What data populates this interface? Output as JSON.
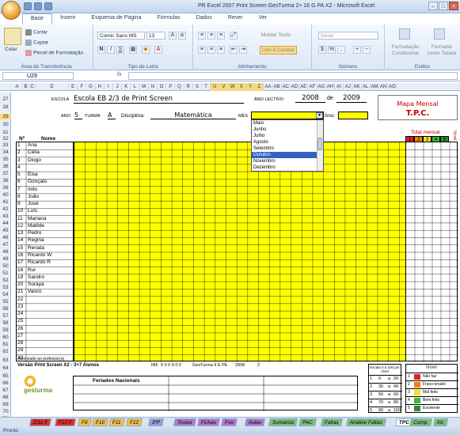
{
  "window": {
    "title": "PR Excel 2007 Print Screen GesTurma 2+ 16 G PA X2 - Microsoft Excel"
  },
  "ribbon": {
    "tabs": [
      "Base",
      "Inserir",
      "Esquema de Página",
      "Fórmulas",
      "Dados",
      "Rever",
      "Ver"
    ],
    "clipboard": {
      "paste": "Colar",
      "cut": "Cortar",
      "copy": "Copiar",
      "format_painter": "Pincel de Formatação",
      "group": "Área de Transferência"
    },
    "font": {
      "name": "Comic Sans MS",
      "size": "13",
      "group": "Tipo de Letra"
    },
    "alignment": {
      "wrap": "Moldar Texto",
      "merge": "Unir e Centrar",
      "group": "Alinhamento"
    },
    "number": {
      "format": "Geral",
      "group": "Número"
    },
    "styles": {
      "conditional": "Formatação Condicional",
      "as_table": "Formatar como Tabela",
      "group": "Estilos"
    }
  },
  "formula_bar": {
    "name_box": "U29",
    "fx": "fx"
  },
  "columns": [
    "A",
    "B",
    "C",
    "D",
    "E",
    "F",
    "G",
    "H",
    "I",
    "J",
    "K",
    "L",
    "M",
    "N",
    "O",
    "P",
    "Q",
    "R",
    "S",
    "T",
    "U",
    "V",
    "W",
    "X",
    "Y",
    "Z",
    "AA",
    "AB",
    "AC",
    "AD",
    "AE",
    "AF",
    "AG",
    "AH",
    "AI",
    "AJ",
    "AK",
    "AL",
    "AM",
    "AN",
    "AO"
  ],
  "rows": [
    "27",
    "28",
    "29",
    "30",
    "31",
    "32",
    "33",
    "34",
    "35",
    "36",
    "37",
    "38",
    "39",
    "40",
    "41",
    "42",
    "43",
    "44",
    "45",
    "46",
    "47",
    "48",
    "49",
    "50",
    "51",
    "52",
    "53",
    "54",
    "55",
    "56",
    "57",
    "58",
    "59",
    "60",
    "61",
    "62",
    "63",
    "64",
    "65",
    "66",
    "67",
    "68",
    "69",
    "70",
    "71",
    "72"
  ],
  "sheet": {
    "escola_label": "ESCOLA",
    "escola": "Escola EB 2/3 de Print Screen",
    "ano_lectivo_label": "ANO LECTIVO",
    "ano_inicio": "2008",
    "de": "de",
    "ano_fim": "2009",
    "mapa_title": "Mapa Mensal",
    "mapa_sub": "T.P.C.",
    "ano_label": "ANO",
    "ano": "5",
    "turma_label": "TURMA",
    "turma": "A",
    "disciplina_label": "Disciplina:",
    "disciplina": "Matemática",
    "mes_label": "MÊS",
    "ano2_label": "Ano:",
    "n_label": "Nº",
    "nome_label": "Nome",
    "total_label": "Total mensal",
    "nivel_side": "Nível",
    "total_cols": [
      "1",
      "2",
      "3",
      "4",
      "5"
    ],
    "month_options": [
      "Maio",
      "Junho",
      "Julho",
      "Agosto",
      "Setembro",
      "Outubro",
      "Novembro",
      "Dezembro"
    ],
    "month_selected": "Outubro",
    "students": [
      {
        "n": "1",
        "nome": "Ana"
      },
      {
        "n": "2",
        "nome": "Célia"
      },
      {
        "n": "3",
        "nome": "Diogo"
      },
      {
        "n": "4",
        "nome": ""
      },
      {
        "n": "5",
        "nome": "Elsa"
      },
      {
        "n": "6",
        "nome": "Gonçalo"
      },
      {
        "n": "7",
        "nome": "Inês"
      },
      {
        "n": "8",
        "nome": "João"
      },
      {
        "n": "9",
        "nome": "José"
      },
      {
        "n": "10",
        "nome": "Luís"
      },
      {
        "n": "11",
        "nome": "Mariana"
      },
      {
        "n": "12",
        "nome": "Matilde"
      },
      {
        "n": "13",
        "nome": "Pedro"
      },
      {
        "n": "14",
        "nome": "Regina"
      },
      {
        "n": "15",
        "nome": "Renata"
      },
      {
        "n": "16",
        "nome": "Ricardo W"
      },
      {
        "n": "17",
        "nome": "Ricardo R"
      },
      {
        "n": "18",
        "nome": "Rui"
      },
      {
        "n": "19",
        "nome": "Sandro"
      },
      {
        "n": "20",
        "nome": "Soraya"
      },
      {
        "n": "21",
        "nome": "Vasco"
      },
      {
        "n": "22",
        "nome": ""
      },
      {
        "n": "23",
        "nome": ""
      },
      {
        "n": "24",
        "nome": ""
      },
      {
        "n": "25",
        "nome": ""
      },
      {
        "n": "26",
        "nome": ""
      },
      {
        "n": "27",
        "nome": ""
      },
      {
        "n": "28",
        "nome": ""
      },
      {
        "n": "29",
        "nome": ""
      },
      {
        "n": "30",
        "nome": ""
      }
    ],
    "autorizado": "Autorizado ao professor(a)",
    "versao": "Versão Print Screen X2 - 3+7 Alunos",
    "nif_label": "NIF",
    "nif": "0 0 0 0 0 0",
    "gesturma_label": "GesTurma II E PE",
    "gesturma_val": "2008",
    "gesturma_num": "2",
    "feriados": "Feriados Nacionais",
    "logo": "gesturma",
    "scale_header": "Escala 0 a 100 por nível",
    "scale": [
      [
        "1",
        "0",
        "a",
        "29"
      ],
      [
        "2",
        "30",
        "a",
        "49"
      ],
      [
        "3",
        "50",
        "a",
        "69"
      ],
      [
        "4",
        "70",
        "a",
        "89"
      ],
      [
        "5",
        "90",
        "a",
        "100"
      ]
    ],
    "nivel_title": "Nível",
    "nivel_items": [
      {
        "n": "1",
        "label": "Não faz",
        "color": "#e02020"
      },
      {
        "n": "2",
        "label": "Fraco-errado",
        "color": "#f08010"
      },
      {
        "n": "3",
        "label": "Mal feito",
        "color": "#f0e020"
      },
      {
        "n": "4",
        "label": "Bem feito",
        "color": "#38b838"
      },
      {
        "n": "5",
        "label": "Excelente",
        "color": "#2e8b2e"
      }
    ]
  },
  "sheet_tabs": [
    "Z/11 F",
    "F12 F",
    "F9",
    "F10",
    "F11",
    "F12",
    "3ºP",
    "Testes",
    "Fichas",
    "Frei",
    "Aulas",
    "Sumários",
    "PAC",
    "Faltas",
    "Análise Faltas",
    "TPC",
    "Comp.",
    "Int."
  ],
  "status": "Pronto"
}
